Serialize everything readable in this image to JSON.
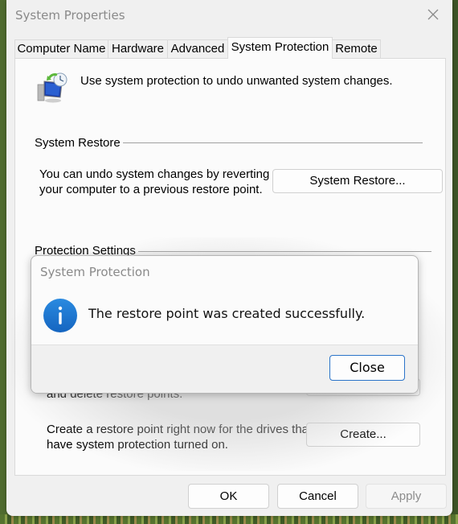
{
  "window": {
    "title": "System Properties",
    "close_icon": "close-x-icon"
  },
  "tabs": [
    {
      "label": "Computer Name",
      "active": false
    },
    {
      "label": "Hardware",
      "active": false
    },
    {
      "label": "Advanced",
      "active": false
    },
    {
      "label": "System Protection",
      "active": true
    },
    {
      "label": "Remote",
      "active": false
    }
  ],
  "panel": {
    "intro_icon": "system-restore-monitor-icon",
    "intro_text": "Use system protection to undo unwanted system changes.",
    "system_restore": {
      "group_label": "System Restore",
      "description_line1": "You can undo system changes by reverting",
      "description_line2": "your computer to a previous restore point.",
      "button_label": "System Restore..."
    },
    "protection_settings": {
      "group_label": "Protection Settings",
      "configure_text_partial": "and delete restore points.",
      "create_line1": "Create a restore point right now for the drives that",
      "create_line2": "have system protection turned on.",
      "create_button_label": "Create..."
    }
  },
  "footer": {
    "ok_label": "OK",
    "cancel_label": "Cancel",
    "apply_label": "Apply",
    "apply_disabled": true
  },
  "modal": {
    "title": "System Protection",
    "icon": "info-icon",
    "message": "The restore point was created successfully.",
    "close_label": "Close",
    "accent_color": "#2b74c9",
    "icon_color": "#1a78d4"
  }
}
